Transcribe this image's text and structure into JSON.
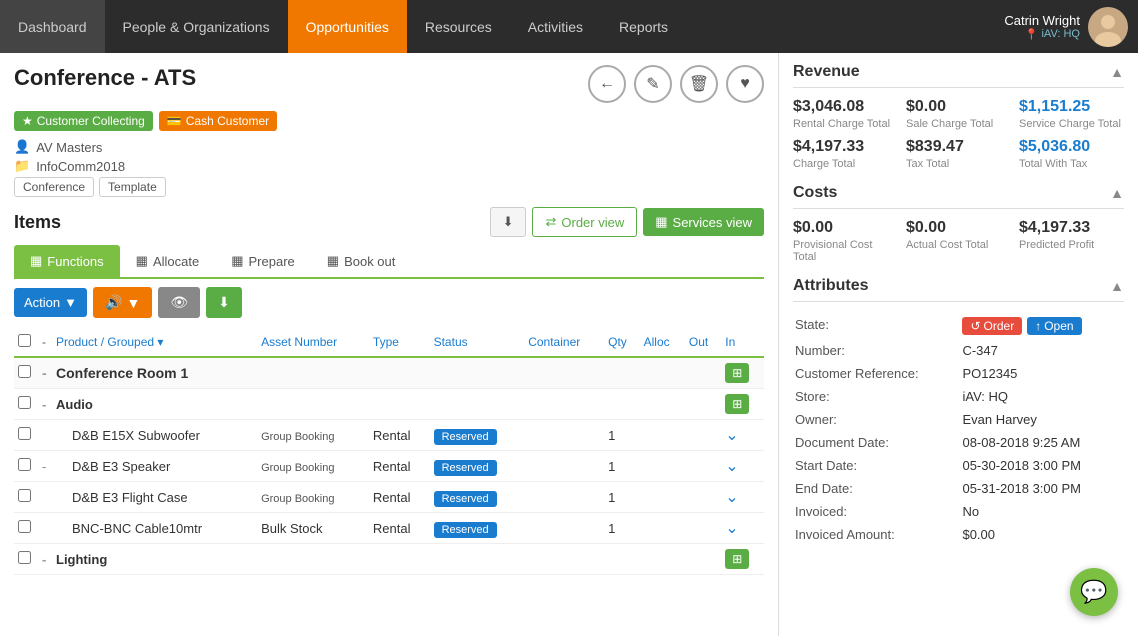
{
  "nav": {
    "items": [
      {
        "label": "Dashboard",
        "active": false
      },
      {
        "label": "People & Organizations",
        "active": false
      },
      {
        "label": "Opportunities",
        "active": true
      },
      {
        "label": "Resources",
        "active": false
      },
      {
        "label": "Activities",
        "active": false
      },
      {
        "label": "Reports",
        "active": false
      }
    ],
    "user": {
      "name": "Catrin Wright",
      "location": "iAV: HQ"
    }
  },
  "record": {
    "title": "Conference - ATS",
    "badges": [
      {
        "label": "Customer Collecting",
        "color": "green",
        "icon": "★"
      },
      {
        "label": "Cash Customer",
        "color": "orange",
        "icon": "💳"
      }
    ],
    "company": "AV Masters",
    "group": "InfoComm2018",
    "tags": [
      "Conference",
      "Template"
    ]
  },
  "header_actions": [
    {
      "icon": "←",
      "name": "back-button"
    },
    {
      "icon": "✎",
      "name": "edit-button"
    },
    {
      "icon": "🗑",
      "name": "delete-button"
    },
    {
      "icon": "♥",
      "name": "favorite-button"
    }
  ],
  "items": {
    "title": "Items",
    "view_btns": {
      "download": "⬇",
      "order_view": "Order view",
      "services_view": "Services view"
    },
    "func_tabs": [
      {
        "label": "Functions",
        "active": true,
        "icon": "▦"
      },
      {
        "label": "Allocate",
        "active": false,
        "icon": "▦"
      },
      {
        "label": "Prepare",
        "active": false,
        "icon": "▦"
      },
      {
        "label": "Book out",
        "active": false,
        "icon": "▦"
      }
    ],
    "action_label": "Action",
    "table": {
      "columns": [
        "",
        "",
        "Product / Grouped",
        "Asset Number",
        "Type",
        "Status",
        "Container",
        "Qty",
        "Alloc",
        "Out",
        "In"
      ],
      "rows": [
        {
          "type": "group",
          "name": "Conference Room 1",
          "indent": 0
        },
        {
          "type": "subgroup",
          "name": "Audio",
          "indent": 1
        },
        {
          "type": "item",
          "name": "D&B E15X Subwoofer",
          "asset_number": "Group Booking",
          "item_type": "Rental",
          "status": "Reserved",
          "qty": "1",
          "indent": 2
        },
        {
          "type": "subitem",
          "name": "D&B E3 Speaker",
          "asset_number": "Group Booking",
          "item_type": "Rental",
          "status": "Reserved",
          "qty": "1",
          "indent": 2
        },
        {
          "type": "item",
          "name": "D&B E3 Flight Case",
          "asset_number": "Group Booking",
          "item_type": "Rental",
          "status": "Reserved",
          "qty": "1",
          "indent": 2
        },
        {
          "type": "item",
          "name": "BNC-BNC Cable10mtr",
          "asset_number": "Bulk Stock",
          "item_type": "Rental",
          "status": "Reserved",
          "qty": "1",
          "indent": 2
        },
        {
          "type": "subgroup",
          "name": "Lighting",
          "indent": 1
        }
      ]
    }
  },
  "revenue": {
    "title": "Revenue",
    "cells": [
      {
        "amount": "$3,046.08",
        "label": "Rental Charge Total",
        "blue": false
      },
      {
        "amount": "$0.00",
        "label": "Sale Charge Total",
        "blue": false
      },
      {
        "amount": "$1,151.25",
        "label": "Service Charge Total",
        "blue": true
      },
      {
        "amount": "$4,197.33",
        "label": "Charge Total",
        "blue": false
      },
      {
        "amount": "$839.47",
        "label": "Tax Total",
        "blue": false
      },
      {
        "amount": "$5,036.80",
        "label": "Total With Tax",
        "blue": true
      }
    ]
  },
  "costs": {
    "title": "Costs",
    "cells": [
      {
        "amount": "$0.00",
        "label": "Provisional Cost Total",
        "blue": false
      },
      {
        "amount": "$0.00",
        "label": "Actual Cost Total",
        "blue": false
      },
      {
        "amount": "$4,197.33",
        "label": "Predicted Profit",
        "blue": false
      }
    ]
  },
  "attributes": {
    "title": "Attributes",
    "state": {
      "label": "State:",
      "badges": [
        {
          "label": "Order",
          "color": "red",
          "icon": "↺"
        },
        {
          "label": "Open",
          "color": "blue",
          "icon": "↑"
        }
      ]
    },
    "fields": [
      {
        "label": "Number:",
        "value": "C-347"
      },
      {
        "label": "Customer Reference:",
        "value": "PO12345"
      },
      {
        "label": "Store:",
        "value": "iAV: HQ"
      },
      {
        "label": "Owner:",
        "value": "Evan Harvey"
      },
      {
        "label": "Document Date:",
        "value": "08-08-2018 9:25 AM"
      },
      {
        "label": "Start Date:",
        "value": "05-30-2018 3:00 PM"
      },
      {
        "label": "End Date:",
        "value": "05-31-2018 3:00 PM"
      },
      {
        "label": "Invoiced:",
        "value": "No"
      },
      {
        "label": "Invoiced Amount:",
        "value": "$0.00"
      }
    ]
  }
}
